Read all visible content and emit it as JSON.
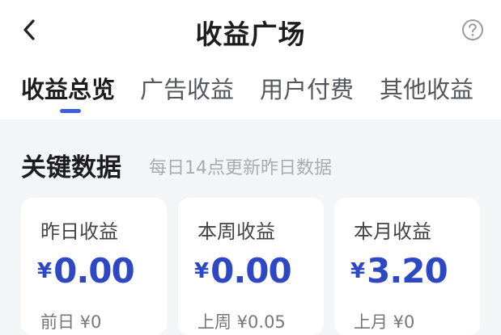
{
  "header": {
    "title": "收益广场",
    "back_icon": "chevron-left-icon",
    "help_icon": "question-circle-icon"
  },
  "tabs": [
    {
      "label": "收益总览",
      "active": true
    },
    {
      "label": "广告收益",
      "active": false
    },
    {
      "label": "用户付费",
      "active": false
    },
    {
      "label": "其他收益",
      "active": false
    }
  ],
  "section": {
    "title": "关键数据",
    "subtitle": "每日14点更新昨日数据"
  },
  "cards": [
    {
      "label": "昨日收益",
      "currency": "¥",
      "value": "0.00",
      "prev": "前日 ¥0"
    },
    {
      "label": "本周收益",
      "currency": "¥",
      "value": "0.00",
      "prev": "上周 ¥0.05"
    },
    {
      "label": "本月收益",
      "currency": "¥",
      "value": "3.20",
      "prev": "上月 ¥0"
    }
  ],
  "colors": {
    "accent": "#3f5fd9",
    "value_text": "#2e47c4",
    "background": "#f4f5f7"
  }
}
